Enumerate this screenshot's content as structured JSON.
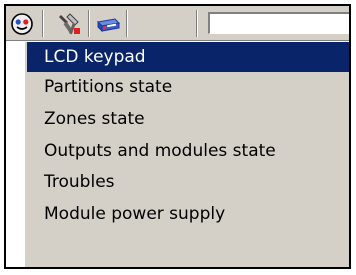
{
  "toolbar": {
    "buttons": [
      {
        "icon": "face-icon"
      },
      {
        "icon": "tools-icon"
      },
      {
        "icon": "keypad-module-icon"
      }
    ],
    "input_value": ""
  },
  "menu": {
    "items": [
      {
        "label": "LCD keypad",
        "selected": true
      },
      {
        "label": "Partitions state",
        "selected": false
      },
      {
        "label": "Zones state",
        "selected": false
      },
      {
        "label": "Outputs and modules state",
        "selected": false
      },
      {
        "label": "Troubles",
        "selected": false
      },
      {
        "label": "Module power supply",
        "selected": false
      }
    ]
  },
  "colors": {
    "face": "#3d3d3d",
    "highlight": "#0a246a",
    "menu_background": "#d4d0c8"
  }
}
